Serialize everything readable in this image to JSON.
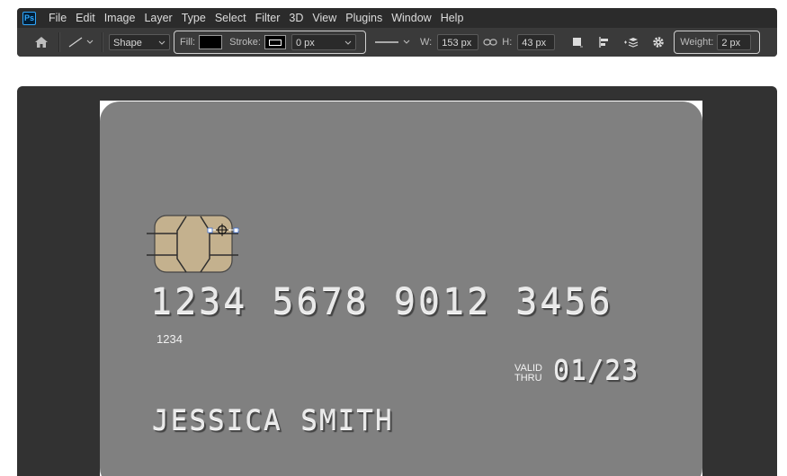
{
  "app": {
    "logo": "Ps"
  },
  "menu": [
    "File",
    "Edit",
    "Image",
    "Layer",
    "Type",
    "Select",
    "Filter",
    "3D",
    "View",
    "Plugins",
    "Window",
    "Help"
  ],
  "options": {
    "mode_value": "Shape",
    "fill_label": "Fill:",
    "fill_color": "#000000",
    "stroke_label": "Stroke:",
    "stroke_width": "0 px",
    "width_label": "W:",
    "width_value": "153 px",
    "height_label": "H:",
    "height_value": "43 px",
    "weight_label": "Weight:",
    "weight_value": "2 px"
  },
  "icons": {
    "home": "home-icon",
    "tool": "line-tool-icon",
    "link": "link-icon",
    "path_ops": "path-operations-icon",
    "align": "path-alignment-icon",
    "arrange": "path-arrangement-icon",
    "gear": "gear-icon"
  },
  "card": {
    "number": "1234 5678 9012 3456",
    "number_small": "1234",
    "valid_line1": "VALID",
    "valid_line2": "THRU",
    "expiry": "01/23",
    "cardholder": "JESSICA SMITH",
    "colors": {
      "body": "#808080",
      "chip": "#c4b18e",
      "canvas_bg": "#323232",
      "toolbar": "#3a3a3a"
    }
  }
}
